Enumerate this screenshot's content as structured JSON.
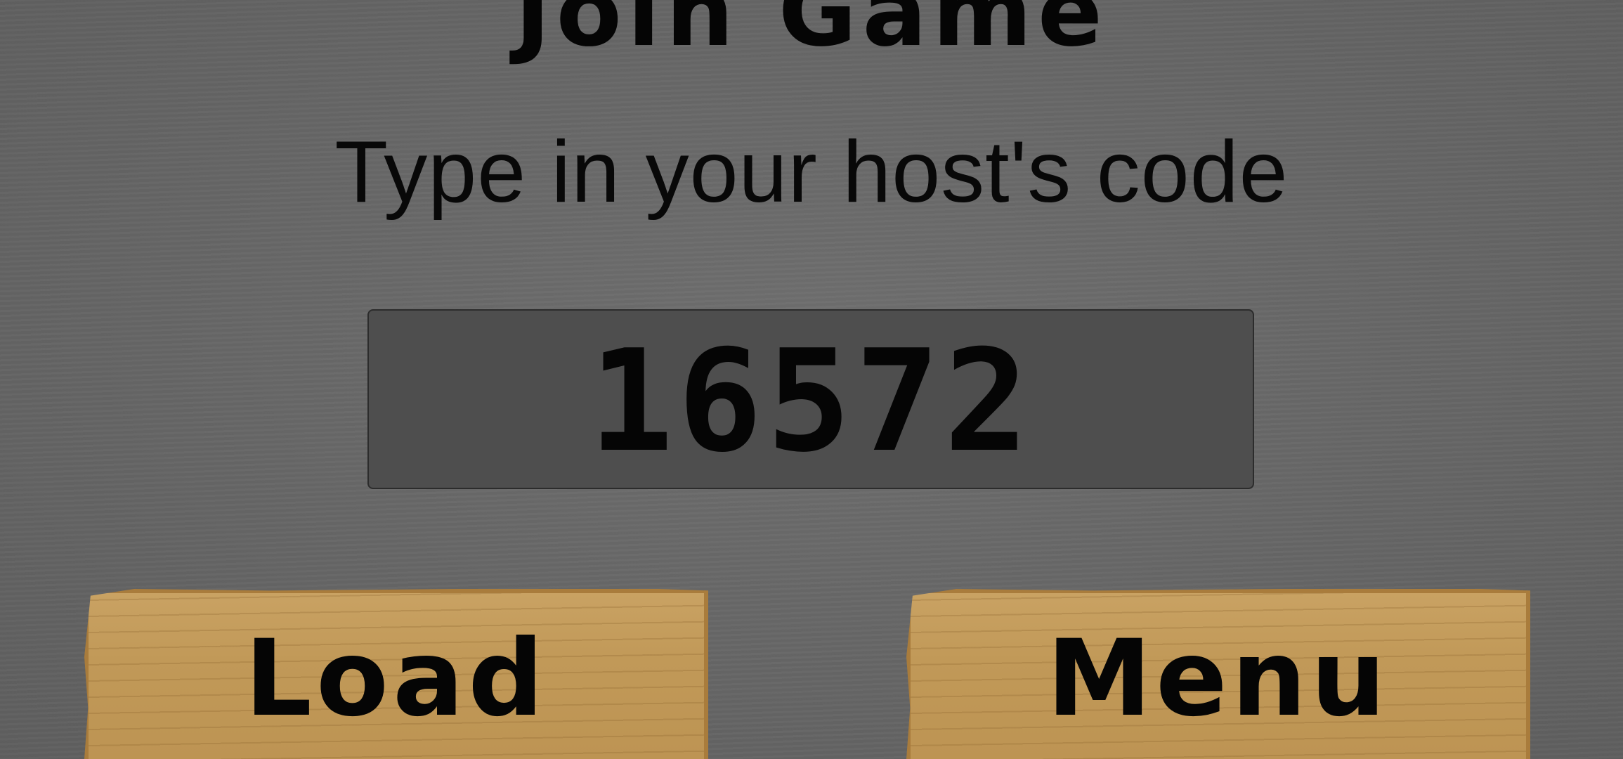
{
  "screen": {
    "title": "Join Game",
    "subtitle": "Type in your host's code",
    "code_value": "16572"
  },
  "buttons": {
    "load_label": "Load",
    "menu_label": "Menu"
  },
  "colors": {
    "background": "#686868",
    "code_field": "#4e4e4e",
    "plank": "#c19958",
    "plank_border": "#a97c3c",
    "text": "#050505"
  }
}
